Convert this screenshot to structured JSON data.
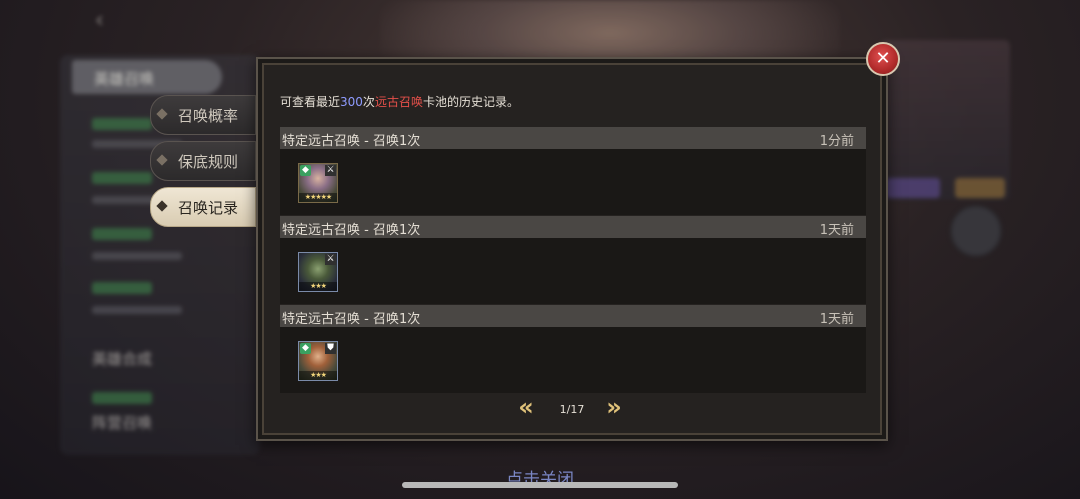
{
  "background": {
    "left_tab_label": "英雄召唤",
    "left_label_1": "英雄合成",
    "left_label_2": "阵营召唤",
    "bottom_hint": "点击关闭"
  },
  "tabs": [
    {
      "label": "召唤概率",
      "active": false
    },
    {
      "label": "保底规则",
      "active": false
    },
    {
      "label": "召唤记录",
      "active": true
    }
  ],
  "intro": {
    "prefix": "可查看最近",
    "count": "300",
    "mid": "次",
    "pool": "远古召唤",
    "suffix": "卡池的历史记录。"
  },
  "records": [
    {
      "title": "特定远古召唤 - 召唤1次",
      "time": "1分前",
      "hero": {
        "stars": "★★★★★",
        "class_icon": "warrior-icon",
        "role_icon": "crossed-swords-icon"
      }
    },
    {
      "title": "特定远古召唤 - 召唤1次",
      "time": "1天前",
      "hero": {
        "stars": "★★★",
        "class_icon": "none",
        "role_icon": "crossed-swords-icon"
      }
    },
    {
      "title": "特定远古召唤 - 召唤1次",
      "time": "1天前",
      "hero": {
        "stars": "★★★",
        "class_icon": "warrior-icon",
        "role_icon": "shield-icon"
      }
    }
  ],
  "pagination": {
    "text": "1/17",
    "prev": "«",
    "next": "»"
  },
  "close": {
    "glyph": "✕"
  },
  "colors": {
    "highlight_count": "#8f9cff",
    "highlight_pool": "#e5504a",
    "star": "#f0d37a"
  }
}
